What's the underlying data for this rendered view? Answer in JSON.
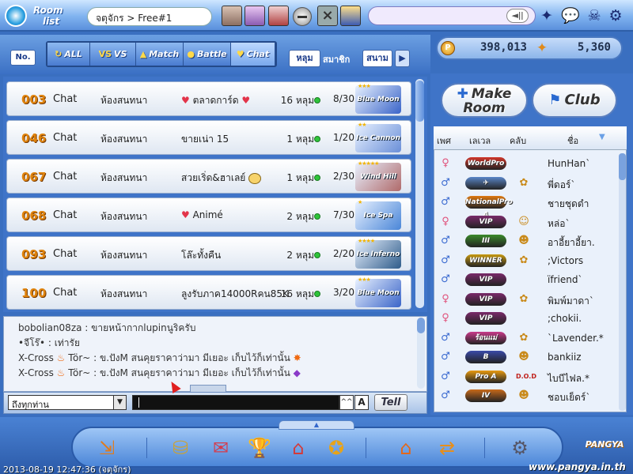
{
  "logo": {
    "line1": "Room",
    "line2": "list"
  },
  "room_name": "จตุจักร > Free#1",
  "top_icons": {
    "star": "✦",
    "chat": "💬",
    "skull": "☠",
    "gear": "⚙",
    "speaker": "◄ǀǀ"
  },
  "tabs": {
    "no_label": "No.",
    "items": [
      {
        "label": "ALL",
        "icon": "↻"
      },
      {
        "label": "VS",
        "icon": "VS"
      },
      {
        "label": "Match",
        "icon": "▲"
      },
      {
        "label": "Battle",
        "icon": "●"
      },
      {
        "label": "Chat",
        "icon": "♥"
      }
    ],
    "sort_hole": "หลุม",
    "sort_member": "สมาชิก",
    "sort_course": "สนาม",
    "sort_next": "▶"
  },
  "currency": {
    "points": "398,013",
    "cookies": "5,360",
    "coin_symbol": "P",
    "cookie_symbol": "✦"
  },
  "rooms": [
    {
      "num": "003",
      "mode": "Chat",
      "category": "ห้องสนทนา",
      "title": "ตลาดการ์ด",
      "holes": "16 หลุม",
      "players": "8/30",
      "course": "Blue Moon",
      "stars": "★★★",
      "color": "#3a64c8"
    },
    {
      "num": "046",
      "mode": "Chat",
      "category": "ห้องสนทนา",
      "title": "ขายเน่า 15",
      "holes": "1 หลุม",
      "players": "1/20",
      "course": "Ice Cannon",
      "stars": "★★",
      "color": "#6a8fd8"
    },
    {
      "num": "067",
      "mode": "Chat",
      "category": "ห้องสนทนา",
      "title": "สวยเริ่ด&ฮาเลย์",
      "holes": "1 หลุม",
      "players": "2/30",
      "course": "Wind Hill",
      "stars": "★★★★★",
      "color": "#b06a6a"
    },
    {
      "num": "068",
      "mode": "Chat",
      "category": "ห้องสนทนา",
      "title": "Animé",
      "holes": "2 หลุม",
      "players": "7/30",
      "course": "Ice Spa",
      "stars": "★",
      "color": "#4a86d8"
    },
    {
      "num": "093",
      "mode": "Chat",
      "category": "ห้องสนทนา",
      "title": "โล๊ะทั้งคืน",
      "holes": "2 หลุม",
      "players": "2/20",
      "course": "Ice Inferno",
      "stars": "★★★★",
      "color": "#2f5c8a"
    },
    {
      "num": "100",
      "mode": "Chat",
      "category": "ห้องสนทนา",
      "title": "ลูงรับภาค14000Rคน85K",
      "holes": "16 หลุม",
      "players": "3/20",
      "course": "Blue Moon",
      "stars": "★★★",
      "color": "#3a64c8"
    }
  ],
  "chat_messages": [
    {
      "name": "bobolian08za",
      "text": " : ขายหน้ากากlupinนูริครับ"
    },
    {
      "name": "•จีโร๊•",
      "text": " : เท่ารัย"
    },
    {
      "name": "X-Cross",
      "text": " Tör~ : ข.ปังM สนคุยราคาว่ามา มีเยอะ เก็บไว้ก็เท่านั้น"
    },
    {
      "name": "X-Cross",
      "text": " Tör~ : ข.ปังM สนคุยราคาว่ามา มีเยอะ เก็บไว้ก็เท่านั้น"
    }
  ],
  "chat_input": {
    "target": "ถึงทุกท่าน",
    "up": "^^",
    "font": "A",
    "tell": "Tell"
  },
  "buttons": {
    "make_room_line1": "Make",
    "make_room_line2": "Room",
    "club": "Club"
  },
  "user_list": {
    "headers": {
      "sex": "เพศ",
      "level": "เลเวล",
      "club": "คลับ",
      "name": "ชื่อ"
    },
    "users": [
      {
        "gender": "♀",
        "badge": "WorldPro",
        "badge_color": "#d0362a",
        "club": "",
        "name": "HunHan`"
      },
      {
        "gender": "♂",
        "badge": "✈",
        "badge_color": "#5a86c8",
        "club": "✿",
        "name": "พี่ดอร์`"
      },
      {
        "gender": "♂",
        "badge": "NationalPro A",
        "badge_color": "#e07a10",
        "club": "",
        "name": "ชายชุดดำ"
      },
      {
        "gender": "♀",
        "badge": "VIP",
        "badge_color": "#7a2a6a",
        "club": "☺",
        "name": "หล่อ`"
      },
      {
        "gender": "♂",
        "badge": "III",
        "badge_color": "#3a8a2a",
        "club": "☻",
        "name": "อาอี้ยาอี้ยา."
      },
      {
        "gender": "♂",
        "badge": "WINNER",
        "badge_color": "#c89a10",
        "club": "✿",
        "name": ";Victors"
      },
      {
        "gender": "♂",
        "badge": "VIP",
        "badge_color": "#7a2a6a",
        "club": "",
        "name": "ïfriend`"
      },
      {
        "gender": "♀",
        "badge": "VIP",
        "badge_color": "#7a2a6a",
        "club": "✿",
        "name": "พิมพ์มาดา`"
      },
      {
        "gender": "♀",
        "badge": "VIP",
        "badge_color": "#7a2a6a",
        "club": "",
        "name": ";chokii."
      },
      {
        "gender": "♂",
        "badge": "ร้อนแม่",
        "badge_color": "#c83a8a",
        "club": "✿",
        "name": "`Lavender.*"
      },
      {
        "gender": "♂",
        "badge": "B",
        "badge_color": "#3a4aa8",
        "club": "☻",
        "name": "bankiiz"
      },
      {
        "gender": "♂",
        "badge": "Pro A",
        "badge_color": "#e89a10",
        "club": "D.O.D",
        "name": "ไบบีไฟล.*"
      },
      {
        "gender": "♂",
        "badge": "IV",
        "badge_color": "#c86a1a",
        "club": "☻",
        "name": "ชอบเย็ดร์`"
      }
    ]
  },
  "dock": {
    "exit": "⇲",
    "shop": "⛁",
    "gift": "✉",
    "trophy": "🏆",
    "home": "⌂",
    "card": "✪",
    "house": "⌂",
    "sort": "⇄",
    "settings": "⚙",
    "tab": "▲"
  },
  "timestamp": "2013-08-19 12:47:36 (จตุจักร)",
  "branding": {
    "logo": "PANGYA",
    "site": "www.pangya.in.th"
  }
}
